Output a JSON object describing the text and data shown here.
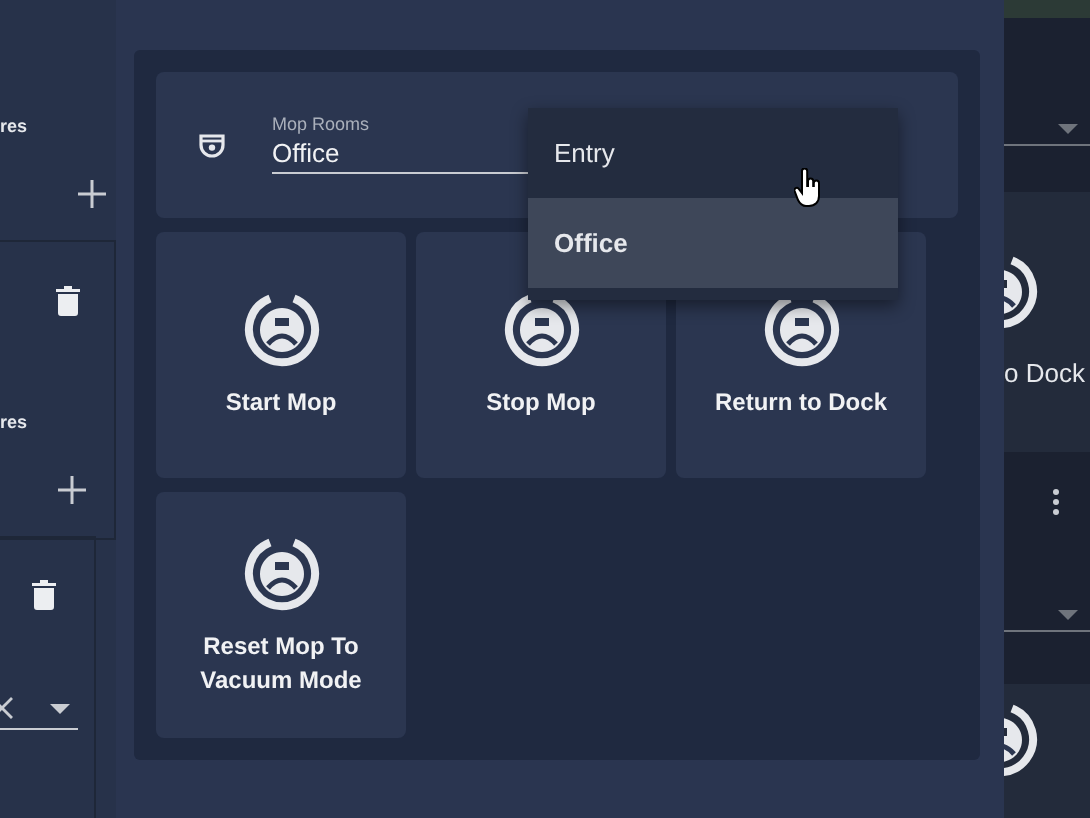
{
  "left_panel": {
    "sections": [
      {
        "label": "res"
      },
      {
        "label": "res"
      }
    ]
  },
  "dialog": {
    "select": {
      "label": "Mop Rooms",
      "value": "Office",
      "options": [
        {
          "label": "Entry",
          "selected": false
        },
        {
          "label": "Office",
          "selected": true
        }
      ]
    },
    "buttons": [
      {
        "label": "Start Mop"
      },
      {
        "label": "Stop Mop"
      },
      {
        "label": "Return to Dock"
      },
      {
        "label": "Reset Mop To Vacuum Mode"
      }
    ]
  },
  "right_panel": {
    "button_label": "o Dock"
  }
}
